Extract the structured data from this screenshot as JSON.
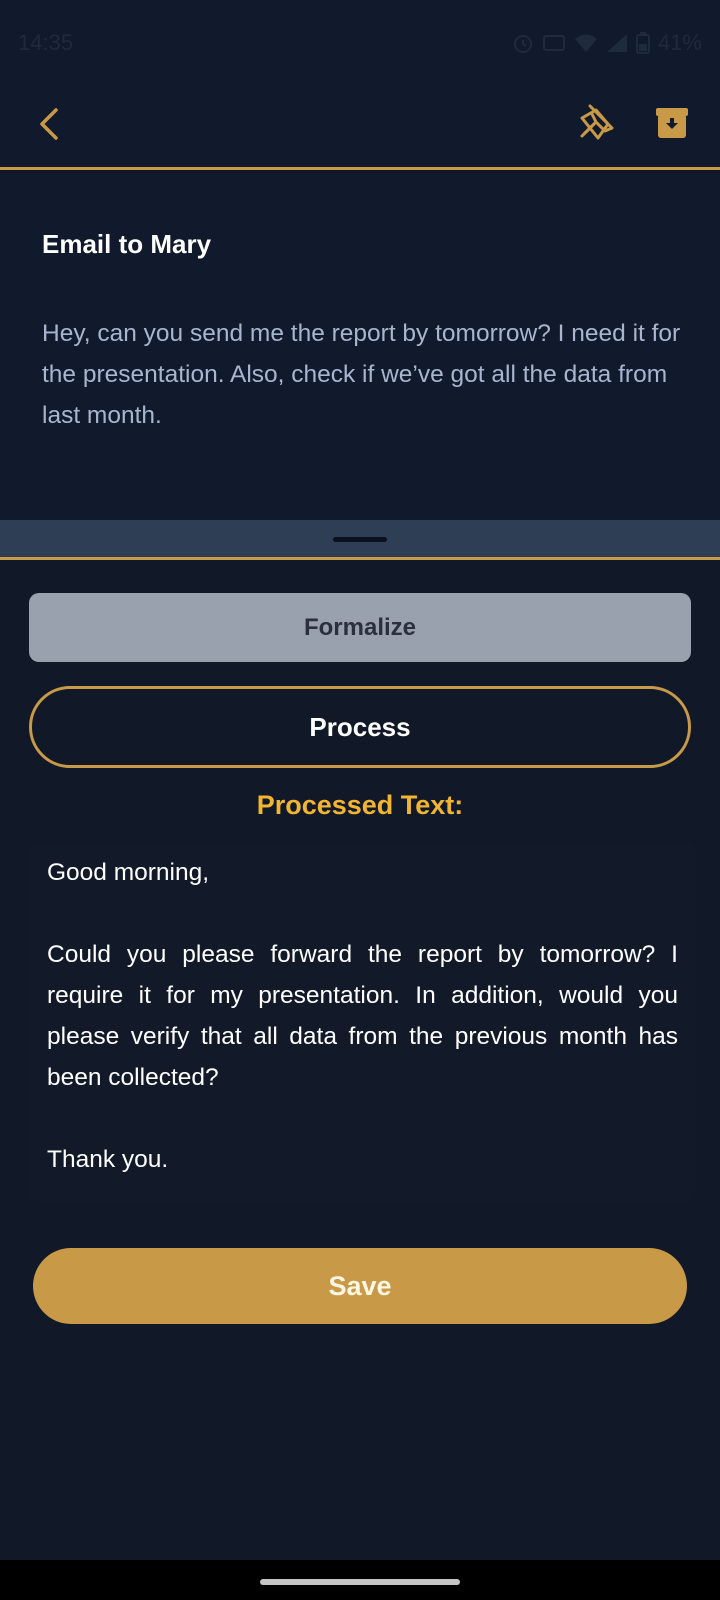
{
  "status_bar": {
    "time": "14:35",
    "battery": "41%",
    "icons": [
      "alarm-icon",
      "volte-icon",
      "wifi-icon",
      "signal-icon",
      "battery-icon"
    ]
  },
  "app_bar": {
    "icons": [
      "back-arrow-icon",
      "pin-icon",
      "archive-icon"
    ],
    "accent_color": "#c89a48"
  },
  "note": {
    "title": "Email to Mary",
    "body": "Hey, can you send me the report by tomorrow? I need it for the presentation. Also, check if we’ve got all the data from last month."
  },
  "panel": {
    "tone_selected": "Formalize",
    "process_label": "Process",
    "processed_label": "Processed Text:",
    "processed_paragraphs": [
      "Good morning,",
      "Could you please forward the report by tomorrow?  I require it for my presentation.  In addition, would you please verify that all data from the previous month has been collected?",
      "Thank you."
    ],
    "save_label": "Save"
  },
  "colors": {
    "background": "#111827",
    "accent": "#c89a48",
    "highlight": "#f2b531"
  }
}
